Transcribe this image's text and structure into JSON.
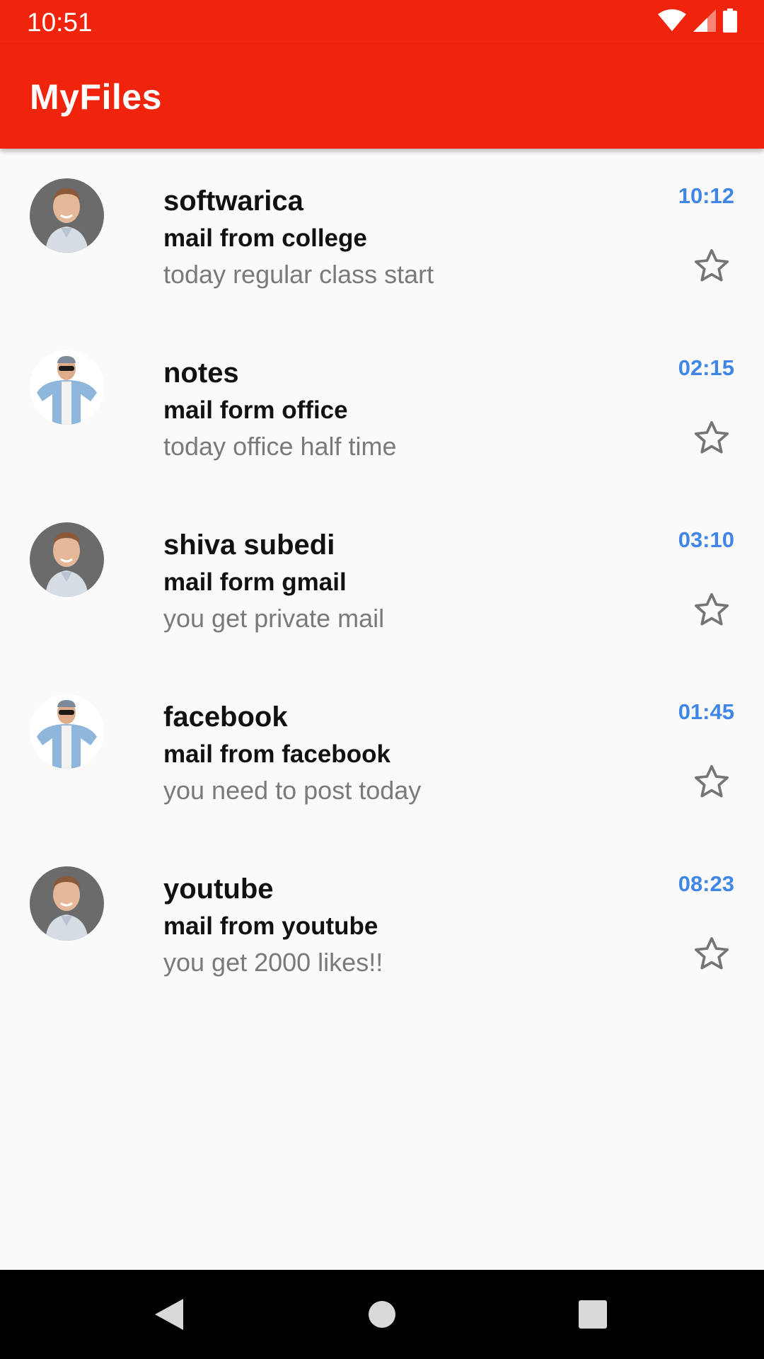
{
  "status_bar": {
    "time": "10:51",
    "icons": [
      "wifi-icon",
      "signal-icon",
      "battery-icon"
    ]
  },
  "app_bar": {
    "title": "MyFiles",
    "color": "#f0230c"
  },
  "colors": {
    "accent_time": "#3f86e6",
    "preview_text": "#7a7a7a"
  },
  "messages": [
    {
      "name": "softwarica",
      "subject": "mail from college",
      "preview": "today regular class start",
      "time": "10:12",
      "avatar": "avatar-man-portrait",
      "starred": false
    },
    {
      "name": "notes",
      "subject": "mail form office",
      "preview": "today office half time",
      "time": "02:15",
      "avatar": "avatar-man-sunglasses",
      "starred": false
    },
    {
      "name": "shiva subedi",
      "subject": "mail form gmail",
      "preview": "you get private mail",
      "time": "03:10",
      "avatar": "avatar-man-portrait",
      "starred": false
    },
    {
      "name": "facebook",
      "subject": "mail from facebook",
      "preview": "you need to post today",
      "time": "01:45",
      "avatar": "avatar-man-sunglasses",
      "starred": false
    },
    {
      "name": "youtube",
      "subject": "mail from youtube",
      "preview": "you get 2000 likes!!",
      "time": "08:23",
      "avatar": "avatar-man-portrait",
      "starred": false
    }
  ],
  "nav_bar": {
    "buttons": [
      "back-icon",
      "home-icon",
      "recents-icon"
    ]
  }
}
